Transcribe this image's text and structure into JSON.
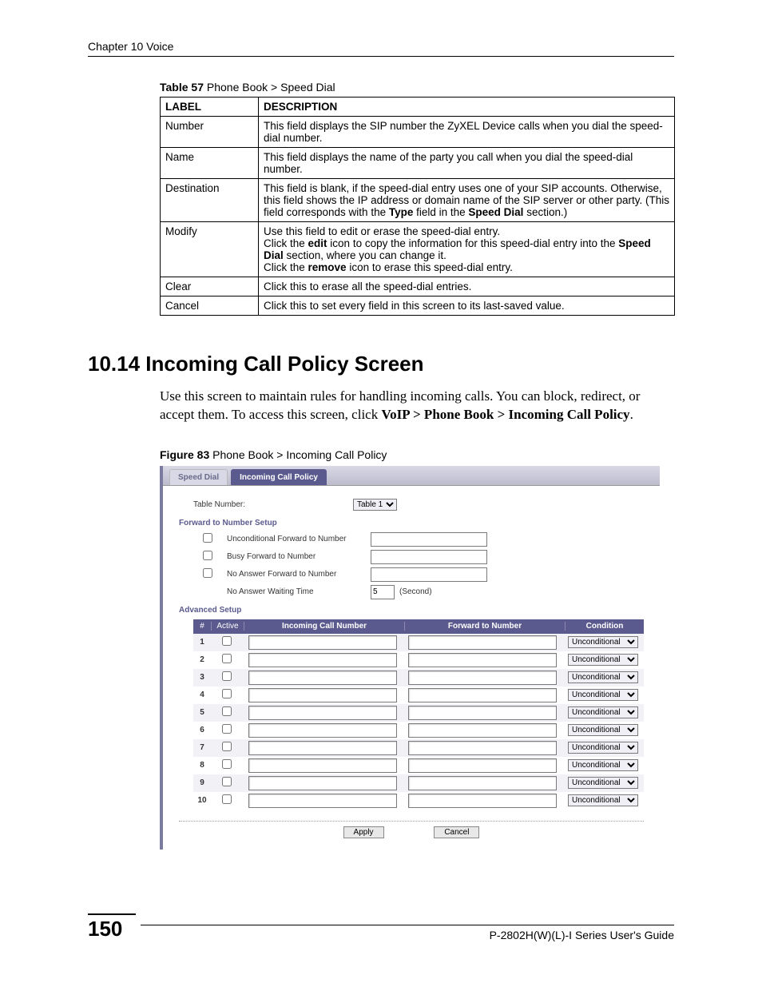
{
  "chapter_header": "Chapter 10 Voice",
  "table57": {
    "caption_bold": "Table 57",
    "caption_rest": "   Phone Book > Speed Dial",
    "head_label": "LABEL",
    "head_desc": "DESCRIPTION",
    "rows": [
      {
        "label": "Number",
        "desc": "This field displays the SIP number the ZyXEL Device calls when you dial the speed-dial number."
      },
      {
        "label": "Name",
        "desc": "This field displays the name of the party you call when you dial the speed-dial number."
      },
      {
        "label": "Destination",
        "desc_html": "This field is blank, if the speed-dial entry uses one of your SIP accounts. Otherwise, this field shows the IP address or domain name of the SIP server or other party. (This field corresponds with the <b>Type</b> field in the <b>Speed Dial</b> section.)"
      },
      {
        "label": "Modify",
        "desc_html": "Use this field to edit or erase the speed-dial entry.<br>Click the <b>edit</b> icon to copy the information for this speed-dial entry into the <b>Speed Dial</b> section, where you can change it.<br>Click the <b>remove</b> icon to erase this speed-dial entry."
      },
      {
        "label": "Clear",
        "desc": "Click this to erase all the speed-dial entries."
      },
      {
        "label": "Cancel",
        "desc": "Click this to set every field in this screen to its last-saved value."
      }
    ]
  },
  "section": {
    "title": "10.14  Incoming Call Policy Screen",
    "body_html": "Use this screen to maintain rules for handling incoming calls. You can block, redirect, or accept them. To access this screen, click <b>VoIP > Phone Book > Incoming Call Policy</b>."
  },
  "figure": {
    "caption_bold": "Figure 83",
    "caption_rest": "   Phone Book > Incoming Call Policy",
    "tabs": {
      "speed": "Speed Dial",
      "incoming": "Incoming Call Policy"
    },
    "table_number_label": "Table Number:",
    "table_number_value": "Table 1",
    "fwd_setup_title": "Forward to Number Setup",
    "fwd_rows": {
      "uncond": "Unconditional Forward to Number",
      "busy": "Busy Forward to Number",
      "noans": "No Answer Forward to Number",
      "wait": "No Answer Waiting Time",
      "wait_val": "5",
      "wait_unit": "(Second)"
    },
    "advanced_title": "Advanced Setup",
    "adv_headers": {
      "num": "#",
      "active": "Active",
      "incoming": "Incoming Call Number",
      "forward": "Forward to Number",
      "condition": "Condition"
    },
    "adv_rows": [
      "1",
      "2",
      "3",
      "4",
      "5",
      "6",
      "7",
      "8",
      "9",
      "10"
    ],
    "condition_value": "Unconditional",
    "apply": "Apply",
    "cancel": "Cancel"
  },
  "footer": {
    "page": "150",
    "guide": "P-2802H(W)(L)-I Series User's Guide"
  }
}
